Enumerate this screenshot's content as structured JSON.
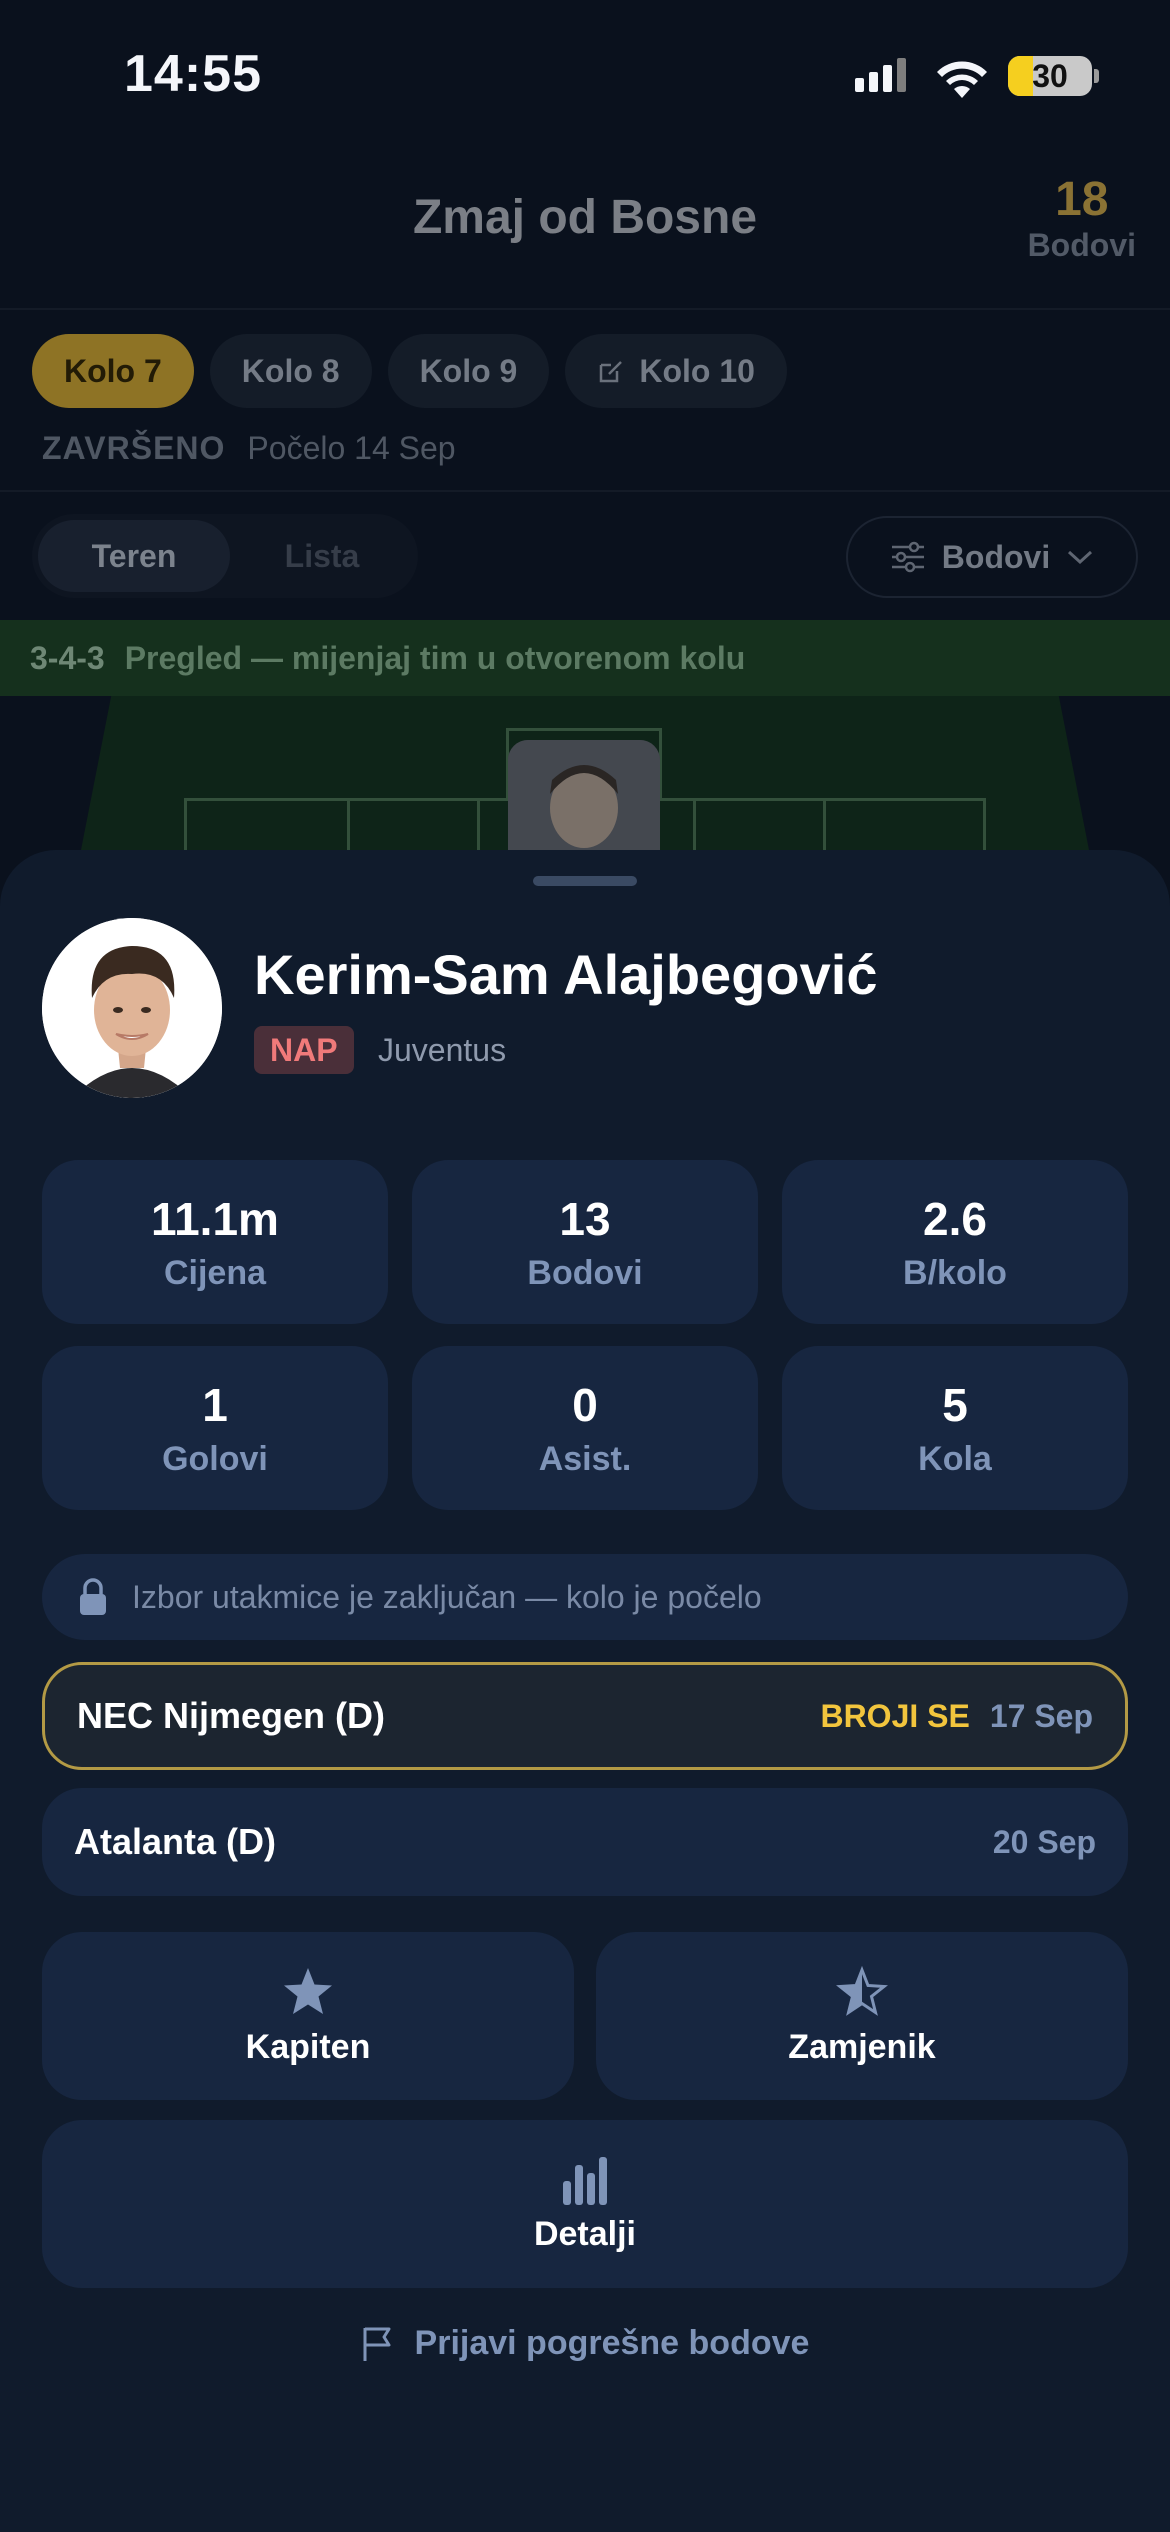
{
  "status_bar": {
    "time": "14:55",
    "battery": "30",
    "battery_fraction": 0.3
  },
  "header": {
    "title": "Zmaj od Bosne",
    "points_value": "18",
    "points_label": "Bodovi"
  },
  "rounds": [
    {
      "label": "Kolo 7",
      "active": true
    },
    {
      "label": "Kolo 8",
      "active": false
    },
    {
      "label": "Kolo 9",
      "active": false
    },
    {
      "label": "Kolo 10",
      "active": false,
      "icon": "edit-icon"
    }
  ],
  "round_status": {
    "state": "ZAVRŠENO",
    "started": "Počelo 14 Sep"
  },
  "view_toggle": {
    "field": "Teren",
    "list": "Lista"
  },
  "sort": {
    "label": "Bodovi",
    "icon": "sliders-icon"
  },
  "formation": {
    "code": "3-4-3",
    "hint": "Pregled — mijenjaj tim u otvorenom kolu"
  },
  "player": {
    "name": "Kerim-Sam Alajbegović",
    "position": "NAP",
    "club": "Juventus"
  },
  "stats": [
    {
      "value": "11.1m",
      "label": "Cijena"
    },
    {
      "value": "13",
      "label": "Bodovi"
    },
    {
      "value": "2.6",
      "label": "B/kolo"
    },
    {
      "value": "1",
      "label": "Golovi"
    },
    {
      "value": "0",
      "label": "Asist."
    },
    {
      "value": "5",
      "label": "Kola"
    }
  ],
  "locked_notice": "Izbor utakmice je zaključan — kolo je počelo",
  "fixtures": [
    {
      "opponent": "NEC Nijmegen (D)",
      "tag": "BROJI SE",
      "date": "17 Sep"
    },
    {
      "opponent": "Atalanta (D)",
      "tag": "",
      "date": "20 Sep"
    }
  ],
  "actions": {
    "captain": "Kapiten",
    "vice": "Zamjenik",
    "details": "Detalji"
  },
  "report": "Prijavi pogrešne bodove",
  "colors": {
    "accent_gold": "#f2c53d",
    "position_badge": "#f07a7a",
    "sheet_bg": "#101b2c",
    "card_bg": "#172640"
  }
}
